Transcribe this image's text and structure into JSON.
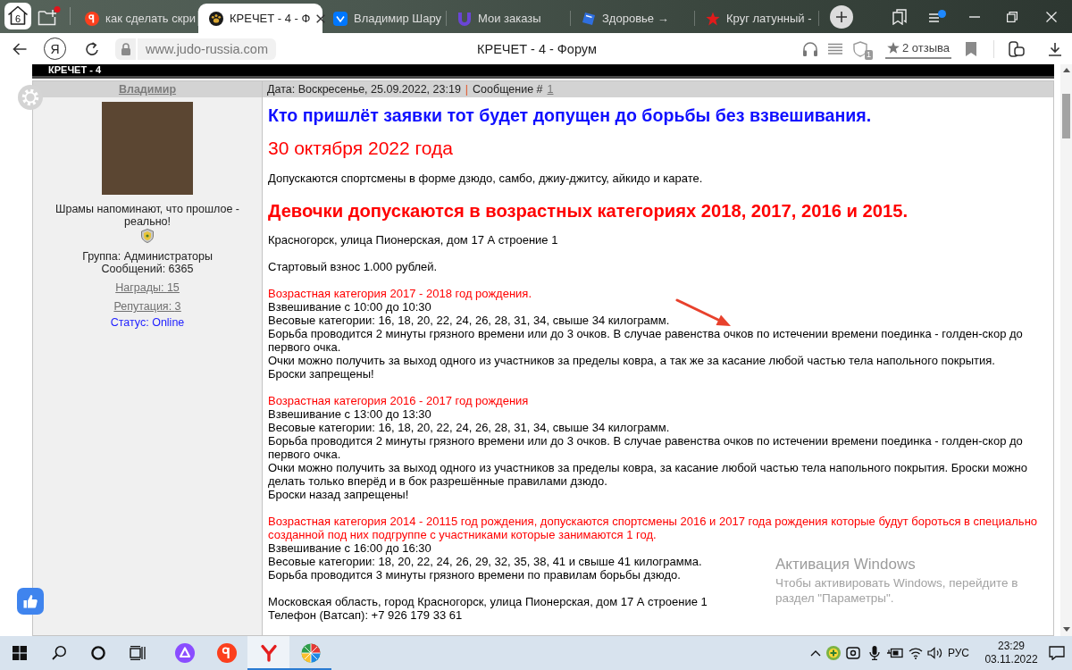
{
  "browser": {
    "tab_count": "6",
    "tabs": [
      {
        "title": "как сделать скри",
        "kind": "ya",
        "selected": false
      },
      {
        "title": "КРЕЧЕТ - 4 - Ф",
        "kind": "paw",
        "selected": true
      },
      {
        "title": "Владимир Шару",
        "kind": "vk",
        "selected": false
      },
      {
        "title": "Мои заказы",
        "kind": "cup",
        "selected": false
      },
      {
        "title": "Здоровье →",
        "kind": "book",
        "selected": false
      },
      {
        "title": "Круг латунный -",
        "kind": "star",
        "selected": false
      }
    ]
  },
  "toolbar": {
    "logo_letter": "Я",
    "url": "www.judo-russia.com",
    "page_title": "КРЕЧЕТ - 4 - Форум",
    "tracker_count": "1",
    "reviews": "2 отзыва"
  },
  "forum": {
    "banner": "КРЕЧЕТ - 4",
    "author": {
      "name": "Владимир",
      "signature": "Шрамы напоминают, что прошлое - реально!",
      "stats": [
        {
          "label": "Группа:",
          "value": "Администраторы",
          "kind": "plain"
        },
        {
          "label": "Сообщений:",
          "value": "6365",
          "kind": "plain"
        },
        {
          "label": "Награды:",
          "value": "15",
          "kind": "link"
        },
        {
          "label": "Репутация:",
          "value": "3",
          "kind": "link"
        },
        {
          "label": "Статус:",
          "value": "Online",
          "kind": "status"
        }
      ]
    },
    "post": {
      "date": "Дата: Воскресенье, 25.09.2022, 23:19",
      "separator": "|",
      "number_label": "Сообщение #",
      "number": "1",
      "blocks": [
        {
          "kind": "headline",
          "text": "Кто пришлёт заявки тот будет допущен до борьбы без взвешивания."
        },
        {
          "kind": "date",
          "text": "30 октября 2022 года"
        },
        {
          "kind": "paragraph",
          "lines": [
            "Допускаются спортсмены в форме дзюдо, самбо, джиу-джитсу, айкидо и карате."
          ]
        },
        {
          "kind": "notice",
          "text": "Девочки допускаются в возрастных категориях 2018, 2017, 2016 и 2015."
        },
        {
          "kind": "paragraph",
          "lines": [
            "Красногорск, улица Пионерская, дом 17 А строение 1"
          ]
        },
        {
          "kind": "paragraph",
          "lines": [
            "Стартовый взнос 1.000 рублей."
          ]
        },
        {
          "kind": "section",
          "heading": "Возрастная категория 2017 - 2018 год рождения.",
          "lines": [
            "Взвешивание с 10:00 до 10:30",
            "Весовые категории: 16, 18, 20, 22, 24, 26, 28, 31, 34, свыше 34 килограмм.",
            "Борьба проводится 2 минуты грязного времени или до 3 очков. В случае равенства очков по истечении времени поединка - голден-скор до первого очка.",
            "Очки можно получить за выход одного из участников за пределы ковра, а так же за касание любой частью тела напольного покрытия.",
            "Броски запрещены!"
          ]
        },
        {
          "kind": "section",
          "heading": "Возрастная категория 2016 - 2017 год рождения",
          "lines": [
            "Взвешивание с 13:00 до 13:30",
            "Весовые категории: 16, 18, 20, 22, 24, 26, 28, 31, 34, свыше 34 килограмм.",
            "Борьба проводится 2 минуты грязного времени или до 3 очков. В случае равенства очков по истечении времени поединка - голден-скор до первого очка.",
            "Очки можно получить за выход одного из участников за пределы ковра, за касание любой частью тела напольного покрытия. Броски можно делать только вперёд и в бок разрешённые правилами дзюдо.",
            "Броски назад запрещены!"
          ]
        },
        {
          "kind": "section",
          "heading": "Возрастная категория 2014 - 20115 год рождения, допускаются спортсмены 2016 и 2017 года рождения которые будут бороться в специально созданной под них подгруппе с участниками которые занимаются 1 год.",
          "lines": [
            "Взвешивание с 16:00 до 16:30",
            "Весовые категории: 18, 20, 22, 24, 26, 29, 32, 35, 38, 41 и свыше 41 килограмма.",
            "Борьба проводится 3 минуты грязного времени по правилам борьбы дзюдо."
          ]
        },
        {
          "kind": "paragraph",
          "lines": [
            "Московская область, город Красногорск, улица Пионерская, дом 17 А строение 1",
            "Телефон (Ватсап): +7 926 179 33 61"
          ]
        }
      ]
    }
  },
  "os_notice": {
    "title": "Активация Windows",
    "lines": [
      "Чтобы активировать Windows, перейдите в",
      "раздел \"Параметры\"."
    ]
  },
  "taskbar": {
    "apps": [
      {
        "kind": "assistant",
        "running": false,
        "selected": false
      },
      {
        "kind": "ya",
        "running": false,
        "selected": false
      },
      {
        "kind": "browser",
        "running": true,
        "selected": true
      },
      {
        "kind": "globe",
        "running": true,
        "selected": false
      }
    ],
    "language": "РУС",
    "time": "23:29",
    "date": "03.11.2022"
  }
}
